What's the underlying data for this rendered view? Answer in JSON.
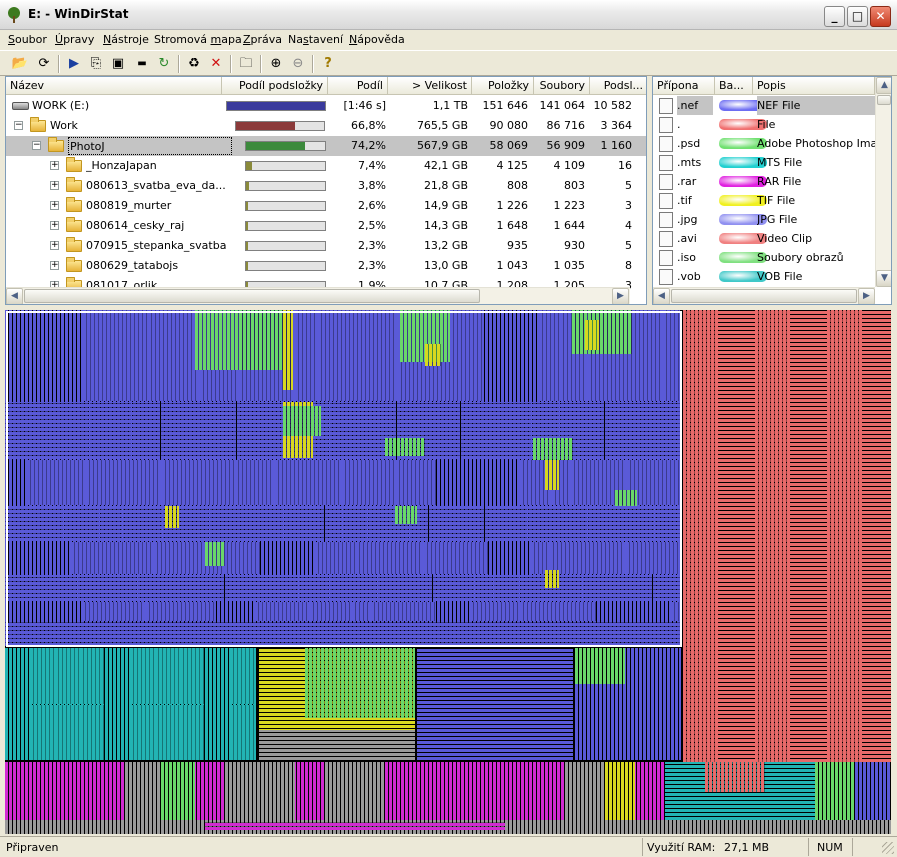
{
  "window": {
    "title": "E: - WinDirStat"
  },
  "menu": [
    {
      "label": "Soubor",
      "u": "S",
      "rest": "oubor"
    },
    {
      "label": "Úpravy",
      "u": "Ú",
      "rest": "pravy"
    },
    {
      "label": "Nástroje",
      "u": "N",
      "rest": "ástroje"
    },
    {
      "label": "Stromová mapa",
      "pre": "Stromová ",
      "u": "m",
      "rest": "apa"
    },
    {
      "label": "Zpráva",
      "u": "Z",
      "rest": "práva"
    },
    {
      "label": "Nastavení",
      "pre": "Na",
      "u": "s",
      "rest": "tavení"
    },
    {
      "label": "Nápověda",
      "u": "N",
      "rest": "ápověda"
    }
  ],
  "toolbar_icons": [
    "open-icon",
    "refresh-icon",
    "play-icon",
    "copy-icon",
    "explorer-icon",
    "cmd-icon",
    "refresh-selected-icon",
    "recycle-icon",
    "delete-icon",
    "new-folder-icon",
    "zoom-in-icon",
    "zoom-out-icon",
    "help-icon"
  ],
  "tree": {
    "columns": [
      "Název",
      "Podíl podsložky",
      "Podíl",
      "> Velikost",
      "Položky",
      "Soubory",
      "Podsl..."
    ],
    "rows": [
      {
        "name": "WORK (E:)",
        "share": "[1:46 s]",
        "size": "1,1 TB",
        "items": "151 646",
        "files": "141 064",
        "subdirs": "10 582",
        "bar": 1.0,
        "color": "#3a3a9c",
        "level": 0,
        "type": "drive"
      },
      {
        "name": "Work",
        "share": "66,8%",
        "size": "765,5 GB",
        "items": "90 080",
        "files": "86 716",
        "subdirs": "3 364",
        "bar": 0.668,
        "color": "#8b3a3a",
        "level": 1,
        "type": "folder"
      },
      {
        "name": "PhotoJ",
        "share": "74,2%",
        "size": "567,9 GB",
        "items": "58 069",
        "files": "56 909",
        "subdirs": "1 160",
        "bar": 0.742,
        "color": "#3c8a3c",
        "level": 2,
        "type": "folder",
        "selected": true
      },
      {
        "name": "_HonzaJapan",
        "share": "7,4%",
        "size": "42,1 GB",
        "items": "4 125",
        "files": "4 109",
        "subdirs": "16",
        "bar": 0.074,
        "color": "#8a8a3a",
        "level": 3,
        "type": "folder"
      },
      {
        "name": "080613_svatba_eva_da...",
        "share": "3,8%",
        "size": "21,8 GB",
        "items": "808",
        "files": "803",
        "subdirs": "5",
        "bar": 0.038,
        "color": "#8a8a3a",
        "level": 3,
        "type": "folder"
      },
      {
        "name": "080819_murter",
        "share": "2,6%",
        "size": "14,9 GB",
        "items": "1 226",
        "files": "1 223",
        "subdirs": "3",
        "bar": 0.026,
        "color": "#8a8a3a",
        "level": 3,
        "type": "folder"
      },
      {
        "name": "080614_cesky_raj",
        "share": "2,5%",
        "size": "14,3 GB",
        "items": "1 648",
        "files": "1 644",
        "subdirs": "4",
        "bar": 0.025,
        "color": "#8a8a3a",
        "level": 3,
        "type": "folder"
      },
      {
        "name": "070915_stepanka_svatba",
        "share": "2,3%",
        "size": "13,2 GB",
        "items": "935",
        "files": "930",
        "subdirs": "5",
        "bar": 0.023,
        "color": "#8a8a3a",
        "level": 3,
        "type": "folder"
      },
      {
        "name": "080629_tatabojs",
        "share": "2,3%",
        "size": "13,0 GB",
        "items": "1 043",
        "files": "1 035",
        "subdirs": "8",
        "bar": 0.023,
        "color": "#8a8a3a",
        "level": 3,
        "type": "folder"
      },
      {
        "name": "081017_orlik",
        "share": "1,9%",
        "size": "10,7 GB",
        "items": "1 208",
        "files": "1 205",
        "subdirs": "3",
        "bar": 0.019,
        "color": "#8a8a3a",
        "level": 3,
        "type": "folder"
      }
    ]
  },
  "extensions": {
    "columns": [
      "Přípona",
      "Ba...",
      "Popis"
    ],
    "rows": [
      {
        "ext": ".nef",
        "desc": "NEF File",
        "color": "#6d6df2",
        "selected": true
      },
      {
        "ext": ".",
        "desc": "File",
        "color": "#f07070"
      },
      {
        "ext": ".psd",
        "desc": "Adobe Photoshop Image",
        "color": "#70e070"
      },
      {
        "ext": ".mts",
        "desc": "MTS File",
        "color": "#20d0d0"
      },
      {
        "ext": ".rar",
        "desc": "RAR File",
        "color": "#e020e0"
      },
      {
        "ext": ".tif",
        "desc": "TIF File",
        "color": "#f0f020"
      },
      {
        "ext": ".jpg",
        "desc": "JPG File",
        "color": "#9090f0"
      },
      {
        "ext": ".avi",
        "desc": "Video Clip",
        "color": "#f08080"
      },
      {
        "ext": ".iso",
        "desc": "Soubory obrazů",
        "color": "#80e080"
      },
      {
        "ext": ".vob",
        "desc": "VOB File",
        "color": "#40c8c8"
      }
    ]
  },
  "status": {
    "left": "Připraven",
    "ram_label": "Využití RAM:",
    "ram_value": "27,1 MB",
    "num": "NUM"
  }
}
